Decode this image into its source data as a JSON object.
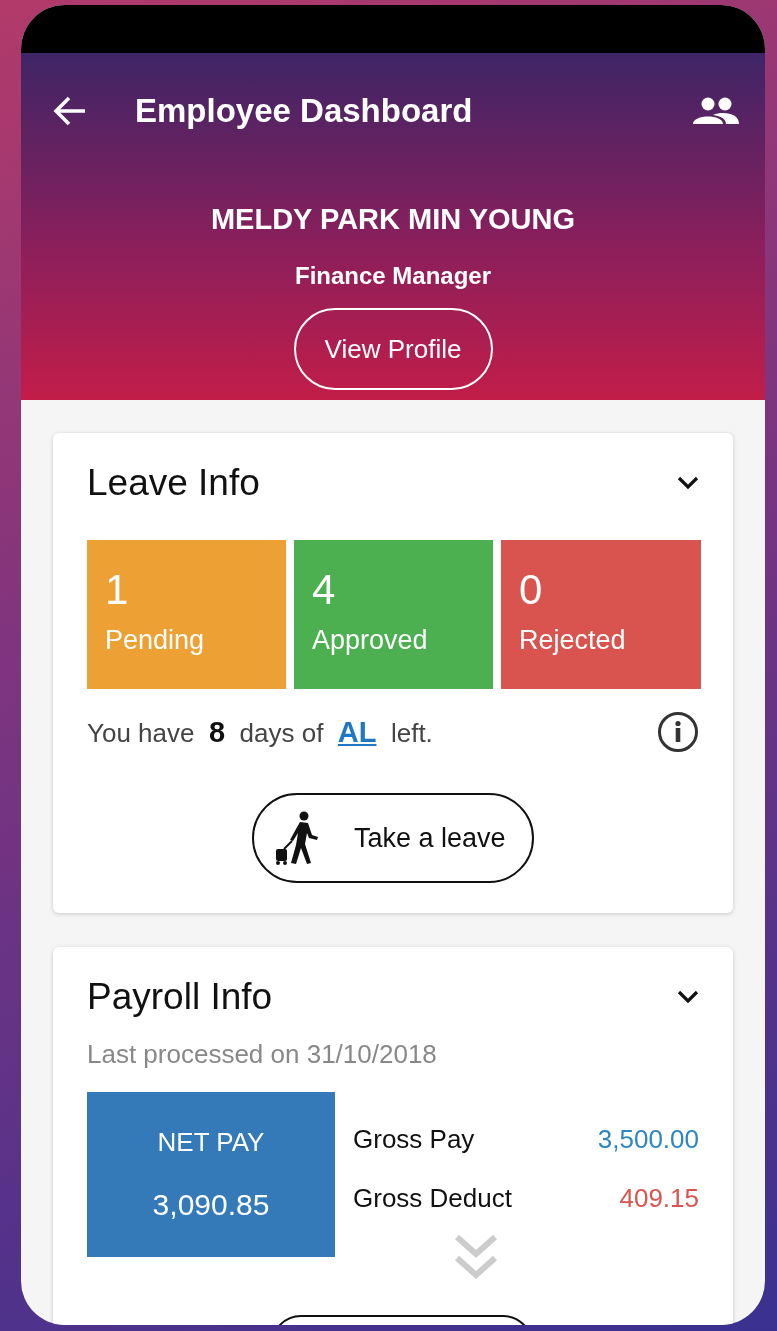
{
  "header": {
    "title": "Employee Dashboard",
    "employee_name": "MELDY PARK MIN YOUNG",
    "job_title": "Finance Manager",
    "profile_button": "View Profile"
  },
  "leave_info": {
    "title": "Leave Info",
    "expanded": true,
    "tiles": [
      {
        "count": "1",
        "label": "Pending",
        "color": "#eda135"
      },
      {
        "count": "4",
        "label": "Approved",
        "color": "#4caf50"
      },
      {
        "count": "0",
        "label": "Rejected",
        "color": "#d9534f"
      }
    ],
    "balance": {
      "before": "You have",
      "days": "8",
      "middle": "days of",
      "link": "AL",
      "after": "left."
    },
    "take_leave_button": "Take a leave"
  },
  "payroll_info": {
    "title": "Payroll Info",
    "expanded": true,
    "last_processed": "Last processed on 31/10/2018",
    "net_pay": {
      "label": "NET PAY",
      "amount": "3,090.85"
    },
    "rows": [
      {
        "label": "Gross Pay",
        "value": "3,500.00",
        "color": "#2e86c1"
      },
      {
        "label": "Gross Deduct",
        "value": "409.15",
        "color": "#d9534f"
      }
    ]
  }
}
